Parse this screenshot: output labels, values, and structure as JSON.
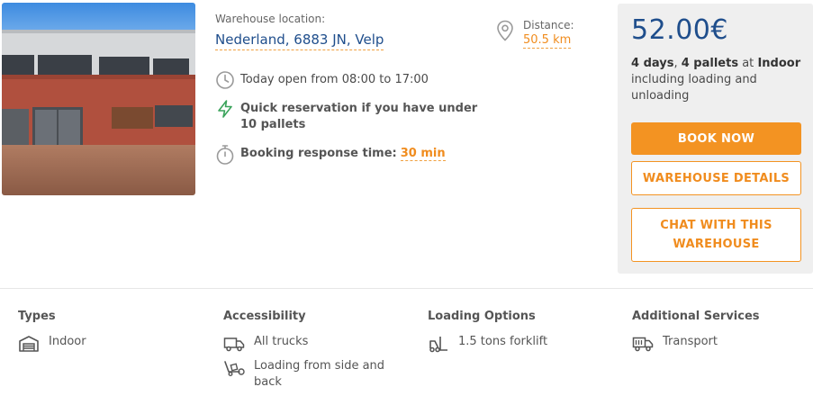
{
  "location": {
    "label": "Warehouse location:",
    "value": "Nederland, 6883 JN, Velp"
  },
  "distance": {
    "label": "Distance:",
    "value": "50.5 km"
  },
  "info": {
    "opening": "Today open from 08:00 to 17:00",
    "quick": "Quick reservation if you have under 10 pallets",
    "response_label": "Booking response time:",
    "response_value": "30 min"
  },
  "pricing": {
    "price": "52.00€",
    "days": "4 days",
    "pallets": "4 pallets",
    "at_word": "at",
    "type": "Indoor",
    "note": "including loading and unloading"
  },
  "buttons": {
    "book": "BOOK NOW",
    "details": "WAREHOUSE DETAILS",
    "chat": "CHAT WITH THIS WAREHOUSE"
  },
  "features": {
    "types": {
      "title": "Types",
      "items": [
        "Indoor"
      ]
    },
    "accessibility": {
      "title": "Accessibility",
      "items": [
        "All trucks",
        "Loading from side and back"
      ]
    },
    "loading": {
      "title": "Loading Options",
      "items": [
        "1.5 tons forklift"
      ]
    },
    "services": {
      "title": "Additional Services",
      "items": [
        "Transport"
      ]
    }
  },
  "icons": {
    "distance": "map-pin-icon",
    "opening": "clock-icon",
    "quick": "lightning-icon",
    "response": "stopwatch-icon",
    "indoor": "warehouse-icon",
    "trucks": "truck-icon",
    "side_loading": "loading-dock-icon",
    "forklift": "forklift-icon",
    "transport": "transport-truck-icon"
  },
  "colors": {
    "accent": "#f39322",
    "brand": "#1f4e8c",
    "quick_icon": "#3aa35b"
  }
}
